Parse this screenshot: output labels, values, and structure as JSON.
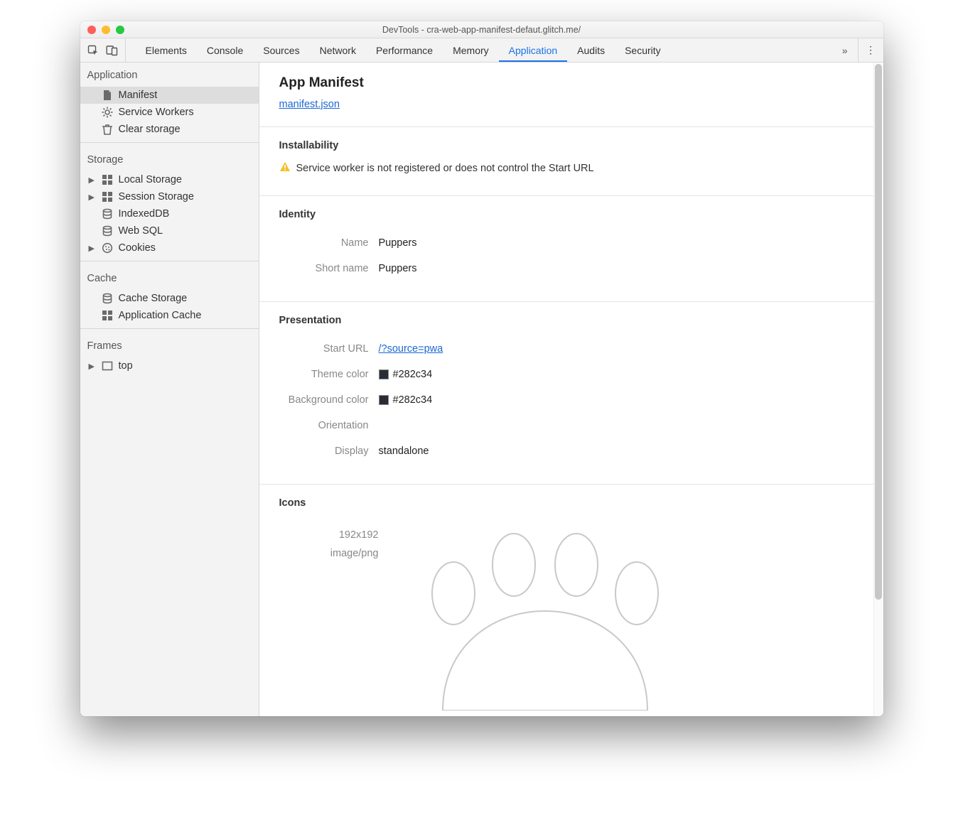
{
  "window": {
    "title": "DevTools - cra-web-app-manifest-defaut.glitch.me/"
  },
  "tabs": {
    "items": [
      "Elements",
      "Console",
      "Sources",
      "Network",
      "Performance",
      "Memory",
      "Application",
      "Audits",
      "Security"
    ],
    "active": "Application",
    "more_glyph": "»",
    "menu_glyph": "⋮"
  },
  "sidebar": {
    "groups": [
      {
        "title": "Application",
        "items": [
          {
            "icon": "file-icon",
            "label": "Manifest",
            "selected": true,
            "expandable": false
          },
          {
            "icon": "gear-icon",
            "label": "Service Workers",
            "selected": false,
            "expandable": false
          },
          {
            "icon": "trash-icon",
            "label": "Clear storage",
            "selected": false,
            "expandable": false
          }
        ]
      },
      {
        "title": "Storage",
        "items": [
          {
            "icon": "grid-icon",
            "label": "Local Storage",
            "selected": false,
            "expandable": true
          },
          {
            "icon": "grid-icon",
            "label": "Session Storage",
            "selected": false,
            "expandable": true
          },
          {
            "icon": "db-icon",
            "label": "IndexedDB",
            "selected": false,
            "expandable": false
          },
          {
            "icon": "db-icon",
            "label": "Web SQL",
            "selected": false,
            "expandable": false
          },
          {
            "icon": "cookie-icon",
            "label": "Cookies",
            "selected": false,
            "expandable": true
          }
        ]
      },
      {
        "title": "Cache",
        "items": [
          {
            "icon": "db-icon",
            "label": "Cache Storage",
            "selected": false,
            "expandable": false
          },
          {
            "icon": "grid-icon",
            "label": "Application Cache",
            "selected": false,
            "expandable": false
          }
        ]
      },
      {
        "title": "Frames",
        "items": [
          {
            "icon": "frame-icon",
            "label": "top",
            "selected": false,
            "expandable": true
          }
        ]
      }
    ]
  },
  "manifest": {
    "heading": "App Manifest",
    "file_link": "manifest.json",
    "installability": {
      "title": "Installability",
      "warning": "Service worker is not registered or does not control the Start URL"
    },
    "identity": {
      "title": "Identity",
      "name_label": "Name",
      "name_value": "Puppers",
      "short_name_label": "Short name",
      "short_name_value": "Puppers"
    },
    "presentation": {
      "title": "Presentation",
      "start_url_label": "Start URL",
      "start_url_value": "/?source=pwa",
      "theme_color_label": "Theme color",
      "theme_color_value": "#282c34",
      "background_color_label": "Background color",
      "background_color_value": "#282c34",
      "orientation_label": "Orientation",
      "orientation_value": "",
      "display_label": "Display",
      "display_value": "standalone"
    },
    "icons": {
      "title": "Icons",
      "size": "192x192",
      "mime": "image/png"
    }
  },
  "colors": {
    "swatch": "#282c34"
  }
}
